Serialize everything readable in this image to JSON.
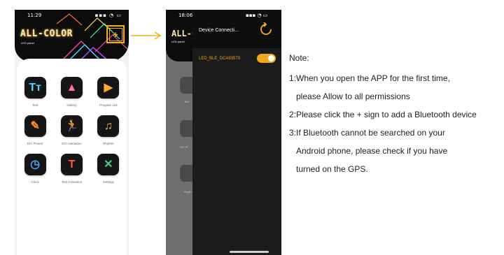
{
  "phone1": {
    "status_time": "11:29",
    "status_icons": "▪▪▪ ◔ ▭",
    "brand": "ALL-COLOR",
    "brand_sub": "LED panel",
    "add_symbol": "+",
    "tiles": [
      {
        "label": "Text",
        "icon": "Tт",
        "color": "#5bd3ff",
        "name": "text"
      },
      {
        "label": "Gallery",
        "icon": "▲",
        "color": "#ff6fa8",
        "name": "gallery"
      },
      {
        "label": "Program List",
        "icon": "▶",
        "color": "#ffa63b",
        "name": "program-list"
      },
      {
        "label": "DIY Picture",
        "icon": "✎",
        "color": "#ff8c2a",
        "name": "diy-picture"
      },
      {
        "label": "DIY Animation",
        "icon": "🏃",
        "color": "#43e07a",
        "name": "diy-animation"
      },
      {
        "label": "Rhythm",
        "icon": "♫",
        "color": "#ffb640",
        "name": "rhythm"
      },
      {
        "label": "Clock",
        "icon": "◷",
        "color": "#4ba8ff",
        "name": "clock"
      },
      {
        "label": "Text Animation",
        "icon": "T",
        "color": "#ff5a3c",
        "name": "text-animation"
      },
      {
        "label": "Settings",
        "icon": "✕",
        "color": "#3dd67c",
        "name": "settings"
      }
    ]
  },
  "phone2": {
    "status_time": "18:06",
    "status_icons": "▪▪▪ ◔ ▭",
    "brand": "ALL-C",
    "brand_sub": "LED panel",
    "panel_title": "Device Connecti...",
    "device_name": "LED_BLE_DCA93570",
    "device_enabled": true,
    "ghost_labels": [
      "Text",
      "DIY Pi",
      "Rhyth"
    ]
  },
  "notes": {
    "title": "Note:",
    "lines": [
      "1:When you open the APP for the first time,",
      "please Allow to all permissions",
      "2:Please click the + sign to add a Bluetooth device",
      "3:If Bluetooth cannot be searched on your",
      "Android phone, please check if you have",
      "turned on the GPS."
    ]
  },
  "colors": {
    "accent": "#f4b020",
    "toggle": "#f0a81c",
    "panel": "#1b1b1b"
  }
}
